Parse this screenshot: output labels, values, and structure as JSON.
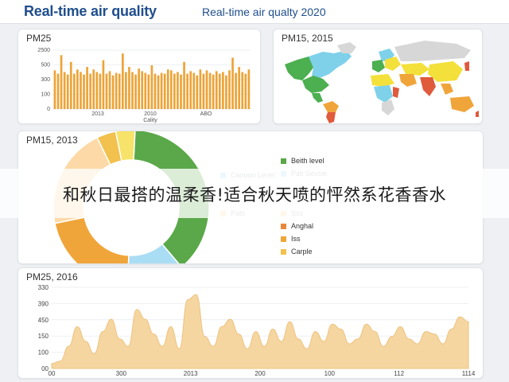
{
  "header": {
    "title": "Real-time air quality",
    "subtitle": "Real-time air qualty 2020"
  },
  "card1": {
    "title": "PM25",
    "x_label": "Cality"
  },
  "card2": {
    "title": "PM15, 2015",
    "colors": {
      "green": "#4caf50",
      "cyan": "#7fd1ea",
      "yellow": "#f3e03a",
      "orange": "#f0a53a",
      "red": "#e05a3c",
      "grey": "#d7d7d7"
    }
  },
  "card3": {
    "title": "PM15, 2013",
    "legend": [
      {
        "label": "Beith level",
        "color": "#5aa849",
        "muted": false
      },
      {
        "label": "Canoon Level",
        "color": "#a9ddf3",
        "muted": true
      },
      {
        "label": "Pati Sevcie",
        "color": "#a9ddf3",
        "muted": true
      },
      {
        "label": "Pats",
        "color": "#fcd9a6",
        "muted": true
      },
      {
        "label": "Sss",
        "color": "#fcd9a6",
        "muted": true
      },
      {
        "label": "Anghal",
        "color": "#e8873a",
        "muted": false
      },
      {
        "label": "Iss",
        "color": "#f0a53a",
        "muted": false
      },
      {
        "label": "Carple",
        "color": "#f2c14e",
        "muted": false
      }
    ]
  },
  "card4": {
    "title": "PM25, 2016"
  },
  "overlay": {
    "text": "和秋日最搭的温柔香!适合秋天喷的怦然系花香香水"
  },
  "chart_data": [
    {
      "type": "bar",
      "title": "PM25",
      "xlabel": "Cality",
      "ylabel": "",
      "ylim": [
        0,
        700
      ],
      "ytick_labels": [
        "0",
        "100",
        "300",
        "500",
        "2500"
      ],
      "xtick_labels": [
        "2013",
        "2010",
        "ABO"
      ],
      "color": "#eda336",
      "values": [
        460,
        420,
        640,
        440,
        410,
        560,
        420,
        470,
        440,
        410,
        500,
        420,
        470,
        440,
        420,
        580,
        420,
        450,
        400,
        430,
        420,
        660,
        440,
        500,
        440,
        410,
        480,
        450,
        430,
        410,
        520,
        420,
        400,
        430,
        420,
        470,
        460,
        420,
        440,
        410,
        560,
        420,
        450,
        430,
        400,
        470,
        420,
        460,
        430,
        410,
        450,
        420,
        440,
        400,
        460,
        610,
        430,
        500,
        440,
        420,
        470
      ]
    },
    {
      "type": "pie",
      "title": "PM15, 2013",
      "donut": true,
      "slices": [
        {
          "label": "Beith level",
          "value": 38,
          "color": "#5aa849"
        },
        {
          "label": "Canoon Level",
          "value": 12,
          "color": "#a9ddf3"
        },
        {
          "label": "Anghal",
          "value": 21,
          "color": "#f0a53a"
        },
        {
          "label": "Pats",
          "value": 21,
          "color": "#fcd9a6"
        },
        {
          "label": "Carple",
          "value": 4,
          "color": "#f2c14e"
        },
        {
          "label": "Iss",
          "value": 4,
          "color": "#f7e36a"
        }
      ]
    },
    {
      "type": "area",
      "title": "PM25, 2016",
      "ylim": [
        0,
        330
      ],
      "ytick_labels": [
        "00",
        "100",
        "150",
        "450",
        "390",
        "330"
      ],
      "xtick_labels": [
        "00",
        "300",
        "2013",
        "200",
        "100",
        "112",
        "1114"
      ],
      "color": "#f5d6a0",
      "values": [
        20,
        30,
        90,
        170,
        110,
        60,
        150,
        200,
        120,
        90,
        240,
        200,
        140,
        90,
        170,
        80,
        280,
        300,
        130,
        90,
        170,
        200,
        140,
        80,
        150,
        90,
        160,
        110,
        190,
        120,
        80,
        150,
        110,
        180,
        160,
        100,
        120,
        180,
        150,
        90,
        130,
        170,
        120,
        100,
        150,
        140,
        100,
        160,
        210,
        190
      ]
    }
  ]
}
